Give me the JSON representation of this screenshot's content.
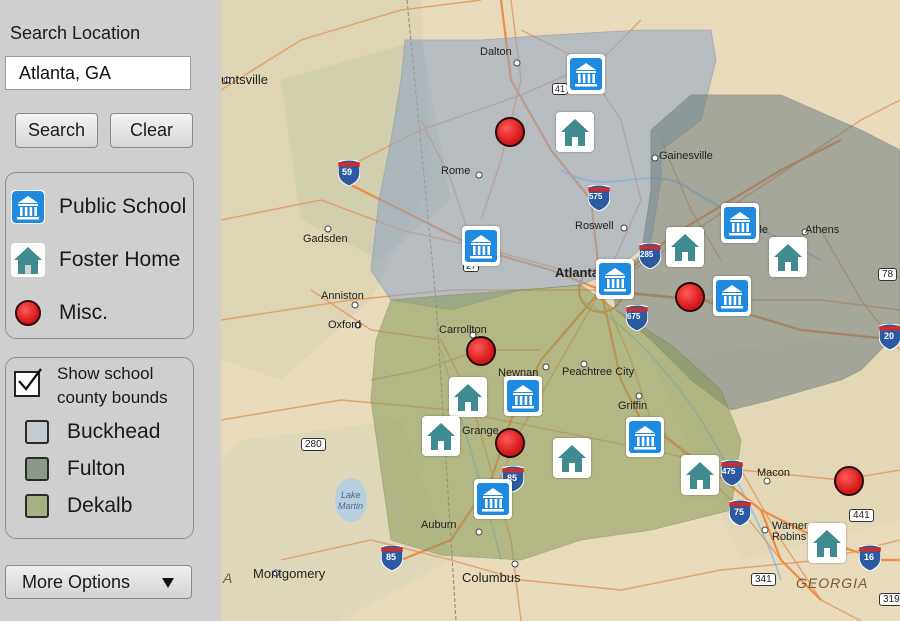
{
  "sidebar": {
    "search_label": "Search Location",
    "search_value": "Atlanta, GA",
    "search_button": "Search",
    "clear_button": "Clear",
    "legend": [
      {
        "label": "Public School",
        "icon": "school-icon"
      },
      {
        "label": "Foster Home",
        "icon": "house-icon"
      },
      {
        "label": "Misc.",
        "icon": "red-dot-icon"
      }
    ],
    "show_bounds_label_line1": "Show school",
    "show_bounds_label_line2": "county bounds",
    "show_bounds_checked": true,
    "counties": [
      {
        "label": "Buckhead",
        "color": "#c3cdd1"
      },
      {
        "label": "Fulton",
        "color": "#8d978c"
      },
      {
        "label": "Dekalb",
        "color": "#a4b183"
      }
    ],
    "more_options": "More Options"
  },
  "map": {
    "places": {
      "dalton": "Dalton",
      "huntsville": "untsville",
      "gainesville": "Gainesville",
      "rome": "Rome",
      "roswell": "Roswell",
      "athens": "Athens",
      "gadsden": "Gadsden",
      "atlanta": "Atlanta",
      "anniston": "Anniston",
      "oxford": "Oxford",
      "carrollton": "Carrollton",
      "newnan": "Newnan",
      "peachtree_city": "Peachtree City",
      "griffin": "Griffin",
      "lagrange": "Grange",
      "macon": "Macon",
      "warner_robins_1": "Warner",
      "warner_robins_2": "Robins",
      "auburn": "Auburn",
      "columbus": "Columbus",
      "montgomery": "Montgomery",
      "georgia": "GEORGIA",
      "lake_martin_1": "Lake",
      "lake_martin_2": "Martin",
      "alabama_fragment": "A",
      "ville_fragment": "ville"
    },
    "shields": {
      "i59": "59",
      "i75a": "575",
      "i75b": "75",
      "i85a": "85",
      "i85b": "85",
      "i675": "675",
      "i285": "285",
      "i20": "20",
      "i16": "16",
      "i475": "475",
      "us27": "27",
      "us41": "41",
      "us78": "78",
      "us280": "280",
      "us341": "341",
      "us441": "441",
      "us319": "319"
    }
  }
}
